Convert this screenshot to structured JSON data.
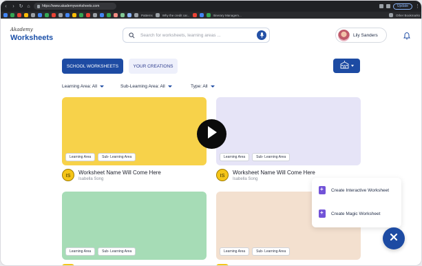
{
  "browser": {
    "url": "https://www.akademyworksheets.com",
    "update_label": "Update",
    "bookmarks": [
      "Patterns",
      "Why the credit car...",
      "Itinerary Managem..."
    ],
    "other_bookmarks": "Other Bookmarks"
  },
  "header": {
    "logo_small": "Akademy",
    "logo_big": "Worksheets",
    "search_placeholder": "Search for worksheets, learning areas ...",
    "user_name": "Lily Sanders"
  },
  "tabs": {
    "primary": "SCHOOL WORKSHEETS",
    "secondary": "YOUR CREATIONS"
  },
  "filters": [
    {
      "label": "Learning Area: All"
    },
    {
      "label": "Sub-Learning Area: All"
    },
    {
      "label": "Type: All"
    }
  ],
  "cards": [
    {
      "color": "#f7d24a",
      "tag1": "Learning Area",
      "tag2": "Sub- Learning Area",
      "initials": "IS",
      "name": "Worksheet Name Will Come Here",
      "author": "Isabella Song"
    },
    {
      "color": "#e6e4f7",
      "tag1": "Learning Area",
      "tag2": "Sub- Learning Area",
      "initials": "IS",
      "name": "Worksheet Name Will Come Here",
      "author": "Isabella Song"
    },
    {
      "color": "#a6dcb6",
      "tag1": "Learning Area",
      "tag2": "Sub- Learning Area"
    },
    {
      "color": "#f3e0cf",
      "tag1": "Learning Area",
      "tag2": "Sub- Learning Area"
    }
  ],
  "popup": {
    "item1": "Create Interactive Worksheet",
    "item2": "Create Magic Worksheet"
  },
  "colors": {
    "brand": "#1d4ba3",
    "accent_purple": "#7253d8",
    "avatar_yellow": "#f5c518"
  },
  "icons": [
    "search-icon",
    "mic-icon",
    "bell-icon",
    "school-icon",
    "play-icon",
    "close-icon",
    "add-document-icon"
  ]
}
